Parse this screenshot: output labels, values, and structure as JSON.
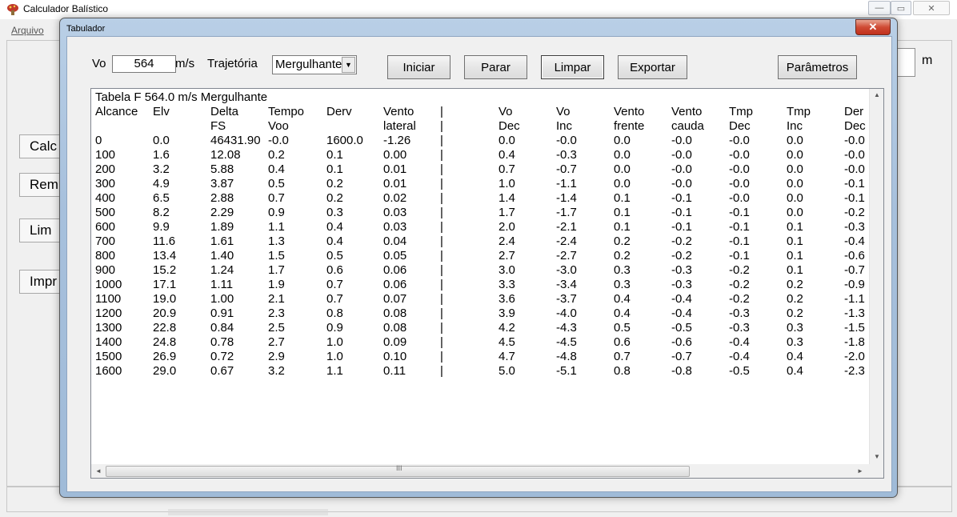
{
  "main": {
    "title": "Calculador Balístico",
    "menu_file": "Arquivo",
    "win_min": "—",
    "win_max": "▭",
    "win_close": "✕",
    "buttons": [
      "Calc",
      "Rem",
      "Lim",
      "Impr"
    ],
    "distance_unit": "m"
  },
  "dialog": {
    "title": "Tabulador",
    "close_glyph": "✕",
    "vo_label": "Vo",
    "vo_value": "564",
    "vo_unit": "m/s",
    "trajectory_label": "Trajetória",
    "trajectory_value": "Mergulhante",
    "btn_start": "Iniciar",
    "btn_stop": "Parar",
    "btn_clear": "Limpar",
    "btn_export": "Exportar",
    "btn_params": "Parâmetros"
  },
  "table": {
    "title": "Tabela F 564.0 m/s  Mergulhante",
    "header1": [
      "Alcance",
      "Elv",
      "Delta",
      "Tempo",
      "Derv",
      "Vento",
      "|",
      "Vo",
      "Vo",
      "Vento",
      "Vento",
      "Tmp",
      "Tmp",
      "Der"
    ],
    "header2": [
      "",
      "",
      "FS",
      "Voo",
      "",
      "lateral",
      "|",
      "Dec",
      "Inc",
      "frente",
      "cauda",
      "Dec",
      "Inc",
      "Dec"
    ],
    "rows": [
      [
        "0",
        "0.0",
        "46431.90",
        "-0.0",
        "1600.0",
        "-1.26",
        "|",
        "0.0",
        "-0.0",
        "0.0",
        "-0.0",
        "-0.0",
        "0.0",
        "-0.0"
      ],
      [
        "100",
        "1.6",
        "12.08",
        "0.2",
        "0.1",
        "0.00",
        "|",
        "0.4",
        "-0.3",
        "0.0",
        "-0.0",
        "-0.0",
        "0.0",
        "-0.0"
      ],
      [
        "200",
        "3.2",
        "5.88",
        "0.4",
        "0.1",
        "0.01",
        "|",
        "0.7",
        "-0.7",
        "0.0",
        "-0.0",
        "-0.0",
        "0.0",
        "-0.0"
      ],
      [
        "300",
        "4.9",
        "3.87",
        "0.5",
        "0.2",
        "0.01",
        "|",
        "1.0",
        "-1.1",
        "0.0",
        "-0.0",
        "-0.0",
        "0.0",
        "-0.1"
      ],
      [
        "400",
        "6.5",
        "2.88",
        "0.7",
        "0.2",
        "0.02",
        "|",
        "1.4",
        "-1.4",
        "0.1",
        "-0.1",
        "-0.0",
        "0.0",
        "-0.1"
      ],
      [
        "500",
        "8.2",
        "2.29",
        "0.9",
        "0.3",
        "0.03",
        "|",
        "1.7",
        "-1.7",
        "0.1",
        "-0.1",
        "-0.1",
        "0.0",
        "-0.2"
      ],
      [
        "600",
        "9.9",
        "1.89",
        "1.1",
        "0.4",
        "0.03",
        "|",
        "2.0",
        "-2.1",
        "0.1",
        "-0.1",
        "-0.1",
        "0.1",
        "-0.3"
      ],
      [
        "700",
        "11.6",
        "1.61",
        "1.3",
        "0.4",
        "0.04",
        "|",
        "2.4",
        "-2.4",
        "0.2",
        "-0.2",
        "-0.1",
        "0.1",
        "-0.4"
      ],
      [
        "800",
        "13.4",
        "1.40",
        "1.5",
        "0.5",
        "0.05",
        "|",
        "2.7",
        "-2.7",
        "0.2",
        "-0.2",
        "-0.1",
        "0.1",
        "-0.6"
      ],
      [
        "900",
        "15.2",
        "1.24",
        "1.7",
        "0.6",
        "0.06",
        "|",
        "3.0",
        "-3.0",
        "0.3",
        "-0.3",
        "-0.2",
        "0.1",
        "-0.7"
      ],
      [
        "1000",
        "17.1",
        "1.11",
        "1.9",
        "0.7",
        "0.06",
        "|",
        "3.3",
        "-3.4",
        "0.3",
        "-0.3",
        "-0.2",
        "0.2",
        "-0.9"
      ],
      [
        "1100",
        "19.0",
        "1.00",
        "2.1",
        "0.7",
        "0.07",
        "|",
        "3.6",
        "-3.7",
        "0.4",
        "-0.4",
        "-0.2",
        "0.2",
        "-1.1"
      ],
      [
        "1200",
        "20.9",
        "0.91",
        "2.3",
        "0.8",
        "0.08",
        "|",
        "3.9",
        "-4.0",
        "0.4",
        "-0.4",
        "-0.3",
        "0.2",
        "-1.3"
      ],
      [
        "1300",
        "22.8",
        "0.84",
        "2.5",
        "0.9",
        "0.08",
        "|",
        "4.2",
        "-4.3",
        "0.5",
        "-0.5",
        "-0.3",
        "0.3",
        "-1.5"
      ],
      [
        "1400",
        "24.8",
        "0.78",
        "2.7",
        "1.0",
        "0.09",
        "|",
        "4.5",
        "-4.5",
        "0.6",
        "-0.6",
        "-0.4",
        "0.3",
        "-1.8"
      ],
      [
        "1500",
        "26.9",
        "0.72",
        "2.9",
        "1.0",
        "0.10",
        "|",
        "4.7",
        "-4.8",
        "0.7",
        "-0.7",
        "-0.4",
        "0.4",
        "-2.0"
      ],
      [
        "1600",
        "29.0",
        "0.67",
        "3.2",
        "1.1",
        "0.11",
        "|",
        "5.0",
        "-5.1",
        "0.8",
        "-0.8",
        "-0.5",
        "0.4",
        "-2.3"
      ]
    ]
  },
  "scroll": {
    "up": "▲",
    "down": "▼",
    "left": "◄",
    "right": "►",
    "grip": "III"
  }
}
